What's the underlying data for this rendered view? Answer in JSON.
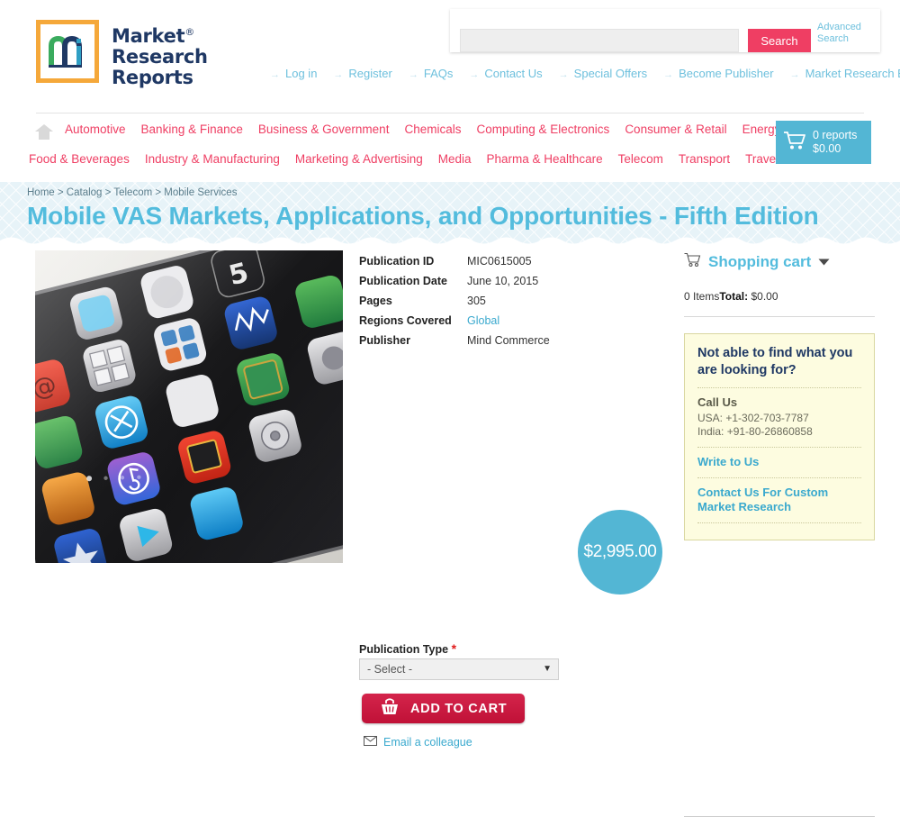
{
  "header": {
    "logo": {
      "line1": "Market",
      "line2": "Research",
      "line3": "Reports",
      "registered": "®",
      "monogram": "m"
    },
    "search": {
      "value": "",
      "placeholder": "",
      "button_label": "Search",
      "advanced_label": "Advanced Search"
    },
    "top_links": [
      {
        "label": "Log in"
      },
      {
        "label": "Register"
      },
      {
        "label": "FAQs"
      },
      {
        "label": "Contact Us"
      },
      {
        "label": "Special Offers"
      },
      {
        "label": "Become Publisher"
      },
      {
        "label": "Market Research Blog"
      }
    ]
  },
  "mainnav": {
    "home_icon": "home-icon",
    "row1": [
      {
        "label": "Automotive"
      },
      {
        "label": "Banking & Finance"
      },
      {
        "label": "Business & Government"
      },
      {
        "label": "Chemicals"
      },
      {
        "label": "Computing & Electronics"
      },
      {
        "label": "Consumer & Retail"
      },
      {
        "label": "Energy & Utilities"
      }
    ],
    "row2": [
      {
        "label": "Food & Beverages"
      },
      {
        "label": "Industry & Manufacturing"
      },
      {
        "label": "Marketing & Advertising"
      },
      {
        "label": "Media"
      },
      {
        "label": "Pharma & Healthcare"
      },
      {
        "label": "Telecom"
      },
      {
        "label": "Transport"
      },
      {
        "label": "Travel & Leisure"
      }
    ],
    "cart": {
      "reports": "0 reports",
      "total": "$0.00"
    }
  },
  "banner": {
    "breadcrumb": "Home > Catalog > Telecom > Mobile Services",
    "breadcrumb_items": [
      "Home",
      "Catalog",
      "Telecom",
      "Mobile Services"
    ],
    "title": "Mobile VAS Markets, Applications, and Opportunities - Fifth Edition"
  },
  "product": {
    "image_alt": "smartphone-app-icons-photo",
    "details": [
      {
        "label": "Publication ID",
        "value": "MIC0615005",
        "is_link": false
      },
      {
        "label": "Publication Date",
        "value": "June 10, 2015",
        "is_link": false
      },
      {
        "label": "Pages",
        "value": "305",
        "is_link": false
      },
      {
        "label": "Regions Covered",
        "value": "Global",
        "is_link": true
      },
      {
        "label": "Publisher",
        "value": "Mind Commerce",
        "is_link": false
      }
    ],
    "publication_type": {
      "label": "Publication Type",
      "required_marker": "*",
      "selected": "- Select -",
      "options": [
        "- Select -"
      ]
    },
    "add_to_cart_label": "ADD TO CART",
    "email_colleague_label": "Email a colleague",
    "price": "$2,995.00"
  },
  "sidebar": {
    "cart_title": "Shopping cart",
    "items_count": "0 Items",
    "total_label": "Total:",
    "total_value": "$0.00",
    "help": {
      "title": "Not able to find what you are looking for?",
      "call_us_label": "Call Us",
      "phone_usa": "USA: +1-302-703-7787",
      "phone_india": "India: +91-80-26860858",
      "write_to_us": "Write to Us",
      "custom_research": "Contact Us For Custom Market Research"
    }
  },
  "colors": {
    "accent_pink": "#ef3e63",
    "accent_blue": "#53bcdd",
    "cart_blue": "#53b6d4",
    "banner_bg": "#e7f3f8",
    "help_bg": "#fdfce0",
    "button_red": "#c01137",
    "logo_orange": "#f5a83a",
    "logo_navy": "#1f3864",
    "logo_green": "#3aab5e"
  }
}
